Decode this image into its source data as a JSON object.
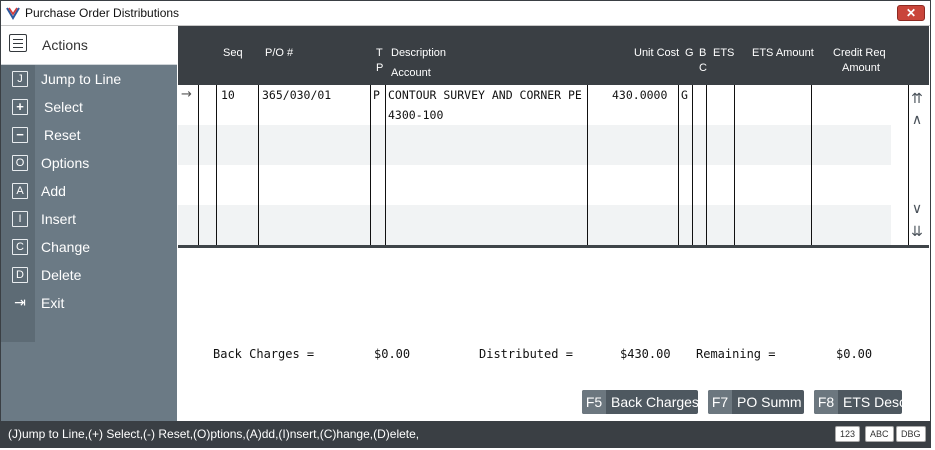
{
  "window": {
    "title": "Purchase Order Distributions",
    "close_label": "✕"
  },
  "sidebar": {
    "header": "Actions",
    "items": [
      {
        "key": "J",
        "label": "Jump to Line",
        "icon": "letter-j-icon"
      },
      {
        "key": "+",
        "label": "Select",
        "icon": "plus-icon"
      },
      {
        "key": "−",
        "label": "Reset",
        "icon": "minus-icon"
      },
      {
        "key": "O",
        "label": "Options",
        "icon": "letter-o-icon"
      },
      {
        "key": "A",
        "label": "Add",
        "icon": "letter-a-icon"
      },
      {
        "key": "I",
        "label": "Insert",
        "icon": "letter-i-icon"
      },
      {
        "key": "C",
        "label": "Change",
        "icon": "letter-c-icon"
      },
      {
        "key": "D",
        "label": "Delete",
        "icon": "letter-d-icon"
      },
      {
        "key": "⇥",
        "label": "Exit",
        "icon": "exit-icon"
      }
    ]
  },
  "grid": {
    "columns": {
      "seq": "Seq",
      "po": "P/O #",
      "tp_t": "T",
      "tp_p": "P",
      "desc": "Description",
      "account": "Account",
      "unit_cost": "Unit Cost",
      "g": "G",
      "bc_b": "B",
      "bc_c": "C",
      "ets": "ETS",
      "ets_amount": "ETS Amount",
      "credit_req": "Credit Req",
      "credit_amount": "Amount"
    },
    "rows": [
      {
        "pointer": "→",
        "seq": "10",
        "po": "365/030/01",
        "tp": "P",
        "description": "CONTOUR SURVEY AND CORNER PE",
        "account": "4300-100",
        "unit_cost": "430.0000",
        "g": "G"
      }
    ],
    "scroll_icons": [
      "⇈",
      "∧",
      "∨",
      "⇊"
    ]
  },
  "totals": {
    "back_charges_label": "Back Charges =",
    "back_charges_value": "$0.00",
    "distributed_label": "Distributed =",
    "distributed_value": "$430.00",
    "remaining_label": "Remaining =",
    "remaining_value": "$0.00"
  },
  "fkeys": [
    {
      "key": "F5",
      "label": "Back Charges"
    },
    {
      "key": "F7",
      "label": "PO Summ"
    },
    {
      "key": "F8",
      "label": "ETS Desc"
    }
  ],
  "status": {
    "hint": "(J)ump to Line,(+) Select,(-) Reset,(O)ptions,(A)dd,(I)nsert,(C)hange,(D)elete,",
    "badges": [
      "123",
      "ABC",
      "DBG"
    ]
  },
  "colors": {
    "header_bg": "#3a3f44",
    "sidebar_bg": "#6b7a85",
    "close_red": "#c9453a"
  }
}
